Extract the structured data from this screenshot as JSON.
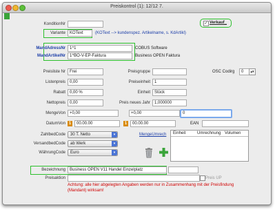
{
  "window": {
    "title": "Preiskontrol (1): 12/12 7."
  },
  "form": {
    "kondition_label": "KonditionNr",
    "variante_label": "Variante",
    "variante_value": "KOText",
    "variante_hint": "(KOText --> kundenspez. Artikelname, s. KdArtikl)",
    "verkauf_label": "Verkauf_",
    "mandadress_label": "MandAdressNr",
    "mandadress_value": "1^1",
    "mandadress_desc": "COBUS Software",
    "mandartikel_label": "MandArtikelNr",
    "mandartikel_value": "1^BO-V-EP-Faktura",
    "mandartikel_desc": "Business OPEN Faktura",
    "preisliste_label": "Preisliste Nr",
    "preisliste_value": "Frei",
    "preisgruppe_label": "Preisgruppe",
    "osc_label": "OSC Codirg",
    "osc_value": "0",
    "listenpreis_label": "Listenpreis",
    "listenpreis_value": "0,00",
    "preiseinheit_label": "Preiseinheit",
    "preiseinheit_value": "1",
    "rabatt_label": "Rabatt",
    "rabatt_value": "0,00 %",
    "einheit_label": "Einheit",
    "einheit_value": "Stück",
    "nettopreis_label": "Nettopreis",
    "nettopreis_value": "0,00",
    "preisjahr_label": "Preis neues Jahr",
    "preisjahr_value": "1,000000",
    "mengevon_label": "MengeVon",
    "mengevon_value": "+0,00",
    "mengebis_value": "+0,00",
    "mengebis_active": "0",
    "datumvon_label": "DatumVon",
    "datumvon_badge": "1",
    "datumvon_value": "00.00.00",
    "datumbis_badge": "1",
    "datumbis_value": "00.00.00",
    "ean_label": "EAN",
    "zahlbed_label": "ZahlbedCode",
    "zahlbed_value": "30 T. Netto",
    "versandbed_label": "VersandbedCode",
    "versandbed_value": "ab Werk",
    "waehrung_label": "WährungCode",
    "waehrung_value": "Euro",
    "mengeumrech_label": "MengeUmrech",
    "umrech_cols": [
      "Einheit",
      "Umrechnung",
      "Volumen"
    ],
    "bezeichnung_label": "Bezeichnung",
    "bezeichnung_value": "Business OPEN V11 Handel Einzelplatz",
    "preis_up_label": "Preis UP",
    "preisaktion_label": "Preisaktion",
    "warning": "Achtung: alle hier abgelegten Angaben werden nur in Zusammenhang mit der Preisfindung (Mandant) wirksam!"
  },
  "colors": {
    "green_highlight": "#2bbf2b",
    "hint_blue": "#1c3ea8",
    "warning_red": "#d00000",
    "badge_orange": "#d98a00",
    "plus_green": "#3aa43a"
  }
}
